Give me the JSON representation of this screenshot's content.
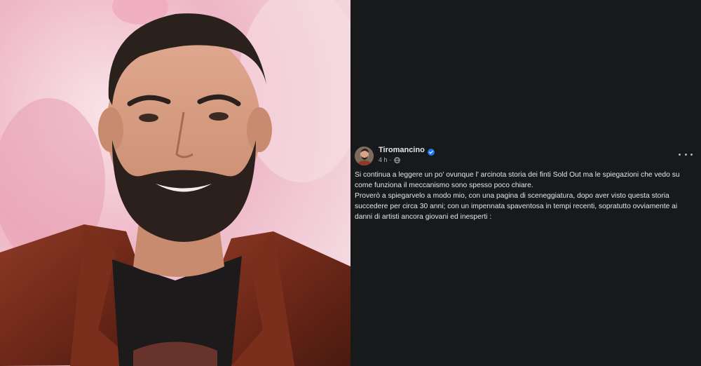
{
  "post": {
    "author": "Tiromancino",
    "timestamp": "4 h",
    "privacy_icon": "globe-icon",
    "verified_icon": "verified-badge-icon",
    "more_icon": "more-options-icon",
    "paragraphs": [
      "Si continua a leggere un po' ovunque l' arcinota  storia dei finti Sold Out ma le spiegazioni che vedo su come funziona il meccanismo sono spesso poco chiare.",
      "Proverò a spiegarvelo a modo mio, con una pagina di sceneggiatura, dopo aver visto questa storia succedere per circa 30 anni; con un impennata spaventosa in tempi recenti, sopratutto ovviamente ai danni di artisti ancora giovani ed inesperti :"
    ]
  },
  "colors": {
    "background": "#18191a",
    "text_primary": "#e4e6eb",
    "text_secondary": "#b0b3b8",
    "verified_blue": "#1877f2"
  }
}
